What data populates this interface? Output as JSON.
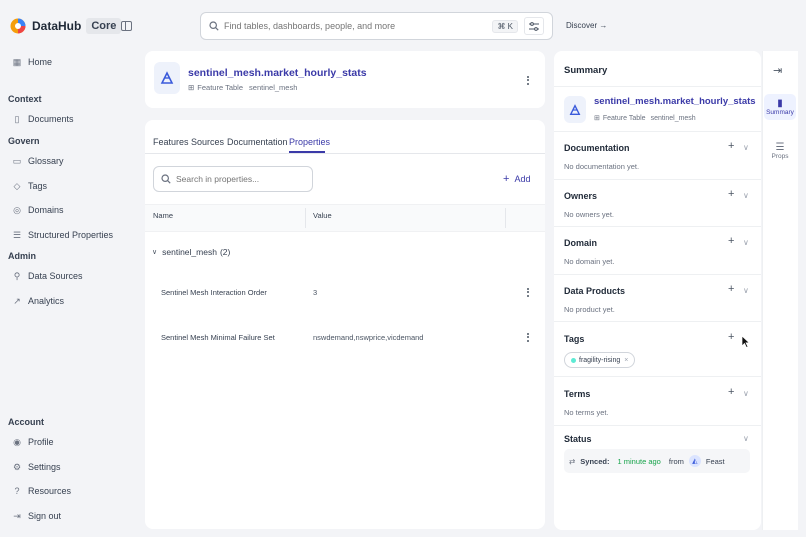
{
  "brand": {
    "name": "DataHub",
    "badge": "Core"
  },
  "search": {
    "placeholder": "Find tables, dashboards, people, and more",
    "shortcut": "⌘ K"
  },
  "discover": "Discover →",
  "sidebar": {
    "home": "Home",
    "context_label": "Context",
    "documents": "Documents",
    "govern_label": "Govern",
    "glossary": "Glossary",
    "tags": "Tags",
    "domains": "Domains",
    "structured_properties": "Structured Properties",
    "admin_label": "Admin",
    "data_sources": "Data Sources",
    "analytics": "Analytics",
    "account_label": "Account",
    "profile": "Profile",
    "settings": "Settings",
    "resources": "Resources",
    "sign_out": "Sign out"
  },
  "entity": {
    "title": "sentinel_mesh.market_hourly_stats",
    "type": "Feature Table",
    "platform": "sentinel_mesh"
  },
  "tabs": [
    "Features",
    "Sources",
    "Documentation",
    "Properties"
  ],
  "properties": {
    "search_placeholder": "Search in properties...",
    "add_label": "Add",
    "col_name": "Name",
    "col_value": "Value",
    "group_label": "sentinel_mesh",
    "group_count": "(2)",
    "rows": [
      {
        "name": "Sentinel Mesh Interaction Order",
        "value": "3"
      },
      {
        "name": "Sentinel Mesh Minimal Failure Set",
        "value": "nswdemand,nswprice,vicdemand"
      }
    ]
  },
  "summary": {
    "heading": "Summary",
    "documentation": {
      "title": "Documentation",
      "empty": "No documentation yet."
    },
    "owners": {
      "title": "Owners",
      "empty": "No owners yet."
    },
    "domain": {
      "title": "Domain",
      "empty": "No domain yet."
    },
    "data_products": {
      "title": "Data Products",
      "empty": "No product yet."
    },
    "tags": {
      "title": "Tags",
      "tag": "fragility-rising",
      "tag_color": "#5eead4"
    },
    "terms": {
      "title": "Terms",
      "empty": "No terms yet."
    },
    "status": {
      "title": "Status",
      "synced": "Synced:",
      "time": "1 minute ago",
      "from": "from",
      "source": "Feast"
    }
  },
  "rail": {
    "summary": "Summary",
    "props": "Props"
  },
  "colors": {
    "accent": "#3b3aa8",
    "success": "#16a34a"
  }
}
